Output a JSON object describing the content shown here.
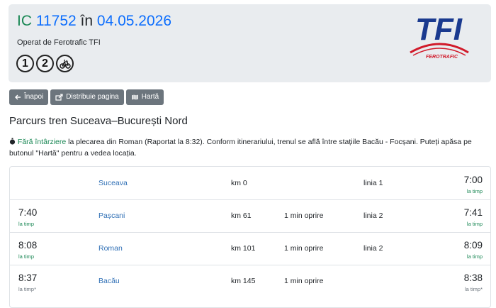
{
  "train": {
    "category": "IC",
    "number": "11752",
    "preposition": "în",
    "date": "04.05.2026",
    "operator": "Operat de Ferotrafic TFI",
    "badges": [
      "1",
      "2",
      "bicycle-icon"
    ]
  },
  "logo": {
    "text": "TFI",
    "subtext": "FEROTRAFIC",
    "color": "#1a3a8f",
    "accent": "#d11a2a"
  },
  "buttons": [
    {
      "icon": "arrow-left-icon",
      "label": "Înapoi"
    },
    {
      "icon": "share-icon",
      "label": "Distribuie pagina"
    },
    {
      "icon": "map-icon",
      "label": "Hartă"
    }
  ],
  "route_title": "Parcurs tren Suceava–București Nord",
  "status": {
    "icon": "stopwatch-icon",
    "highlight": "Fără întârziere",
    "text": " la plecarea din Roman (Raportat la 8:32). Conform itinerariului, trenul se află între stațiile Bacău - Focșani. Puteți apăsa pe butonul \"Hartă\" pentru a vedea locația."
  },
  "stations": [
    {
      "arr_time": "",
      "arr_status": "",
      "name": "Suceava",
      "km": "km 0",
      "stop": "",
      "line": "linia 1",
      "dep_time": "7:00",
      "dep_status": "la timp"
    },
    {
      "arr_time": "7:40",
      "arr_status": "la timp",
      "name": "Pașcani",
      "km": "km 61",
      "stop": "1 min oprire",
      "line": "linia 2",
      "dep_time": "7:41",
      "dep_status": "la timp"
    },
    {
      "arr_time": "8:08",
      "arr_status": "la timp",
      "name": "Roman",
      "km": "km 101",
      "stop": "1 min oprire",
      "line": "linia 2",
      "dep_time": "8:09",
      "dep_status": "la timp"
    },
    {
      "arr_time": "8:37",
      "arr_status": "la timp*",
      "name": "Bacău",
      "km": "km 145",
      "stop": "1 min oprire",
      "line": "",
      "dep_time": "8:38",
      "dep_status": "la timp*"
    }
  ]
}
